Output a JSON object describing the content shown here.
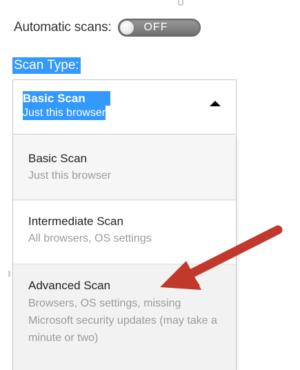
{
  "settings": {
    "automatic_scans_label": "Automatic scans:",
    "toggle_state": "OFF"
  },
  "scan_type": {
    "label": "Scan Type:",
    "selected": {
      "title": "Basic Scan",
      "description": "Just this browser"
    },
    "options": [
      {
        "title": "Basic Scan",
        "description": "Just this browser"
      },
      {
        "title": "Intermediate Scan",
        "description": "All browsers, OS settings"
      },
      {
        "title": "Advanced Scan",
        "description": "Browsers, OS settings, missing Microsoft security updates (may take a minute or two)"
      }
    ]
  },
  "colors": {
    "selection": "#3399ff",
    "arrow": "#c0392b"
  },
  "icons": {
    "caret": "caret-up-icon",
    "annotation": "red-arrow-icon"
  }
}
